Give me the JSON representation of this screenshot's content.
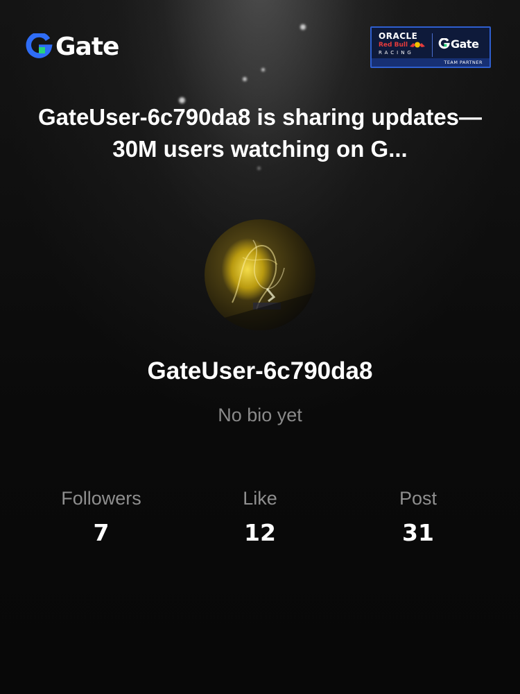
{
  "brand": {
    "logo_text": "Gate",
    "logo_icon": "gate-logo-icon",
    "accent_color": "#2f6df6"
  },
  "partner_badge": {
    "oracle_text": "ORACLE",
    "redbull_text": "Red Bull",
    "racing_text": "RACING",
    "gate_text": "Gate",
    "band_text": "TEAM PARTNER",
    "background_color": "#0e1a3a",
    "border_color": "#2f5fd0"
  },
  "headline": "GateUser-6c790da8 is sharing updates—30M users watching on G...",
  "profile": {
    "username": "GateUser-6c790da8",
    "bio": "No bio yet",
    "avatar": "profile-photo"
  },
  "stats": [
    {
      "label": "Followers",
      "value": "7"
    },
    {
      "label": "Like",
      "value": "12"
    },
    {
      "label": "Post",
      "value": "31"
    }
  ]
}
